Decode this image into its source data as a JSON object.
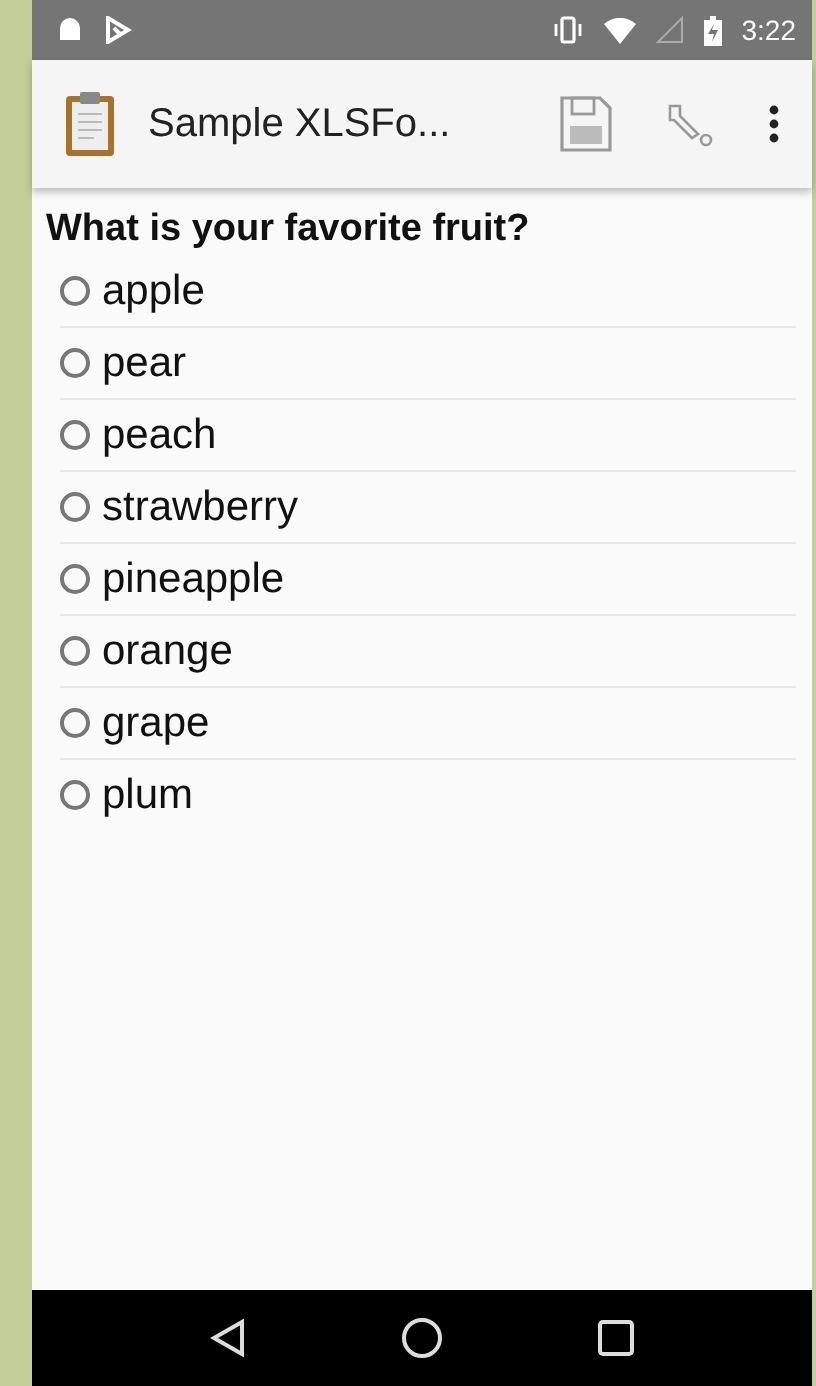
{
  "status_bar": {
    "time": "3:22"
  },
  "app_bar": {
    "title": "Sample XLSFo..."
  },
  "question": {
    "label": "What is your favorite fruit?",
    "options": [
      {
        "label": "apple",
        "selected": false
      },
      {
        "label": "pear",
        "selected": false
      },
      {
        "label": "peach",
        "selected": false
      },
      {
        "label": "strawberry",
        "selected": false
      },
      {
        "label": "pineapple",
        "selected": false
      },
      {
        "label": "orange",
        "selected": false
      },
      {
        "label": "grape",
        "selected": false
      },
      {
        "label": "plum",
        "selected": false
      }
    ]
  }
}
